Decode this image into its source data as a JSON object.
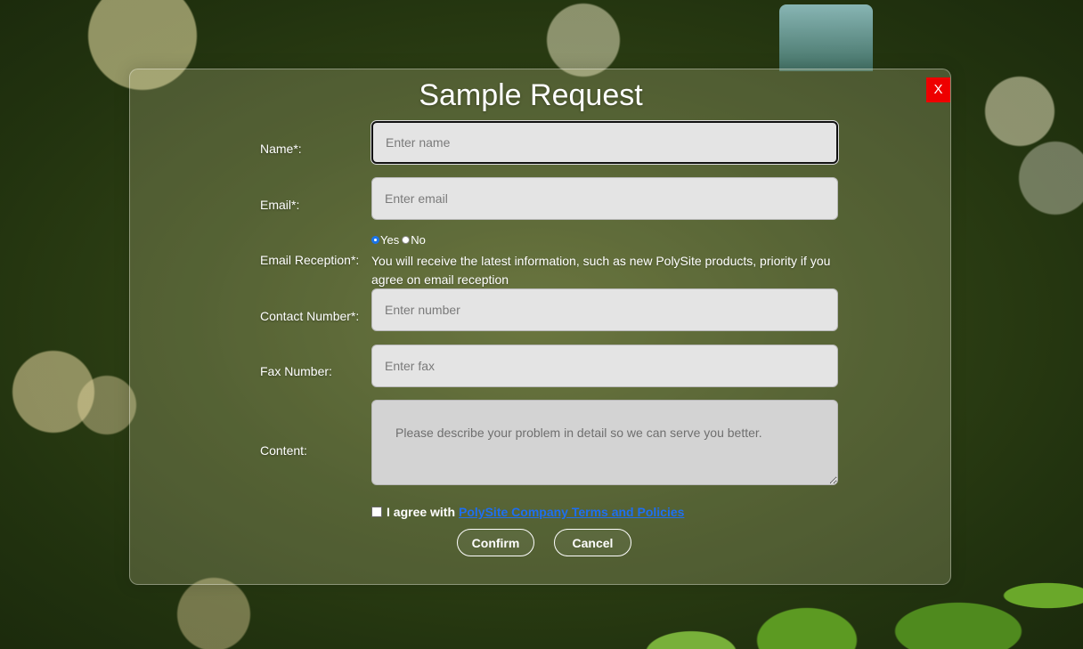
{
  "modal": {
    "title": "Sample Request",
    "close_label": "X"
  },
  "form": {
    "name": {
      "label": "Name*:",
      "placeholder": "Enter name",
      "value": ""
    },
    "email": {
      "label": "Email*:",
      "placeholder": "Enter email",
      "value": ""
    },
    "email_reception": {
      "label": "Email Reception*:",
      "options": [
        "Yes",
        "No"
      ],
      "selected": "Yes",
      "note": "You will receive the latest information, such as new PolySite products, priority if you agree on email reception"
    },
    "contact_number": {
      "label": "Contact Number*:",
      "placeholder": "Enter number",
      "value": ""
    },
    "fax_number": {
      "label": "Fax Number:",
      "placeholder": "Enter fax",
      "value": ""
    },
    "content": {
      "label": "Content:",
      "placeholder": "Please describe your problem in detail so we can serve you better.",
      "value": ""
    },
    "agree": {
      "prefix": "I agree with",
      "link": "PolySite Company Terms and Policies",
      "checked": false
    }
  },
  "buttons": {
    "confirm": "Confirm",
    "cancel": "Cancel"
  },
  "colors": {
    "close_bg": "#ee0000",
    "link": "#1e6ff0",
    "radio_selected": "#1a73e8"
  }
}
